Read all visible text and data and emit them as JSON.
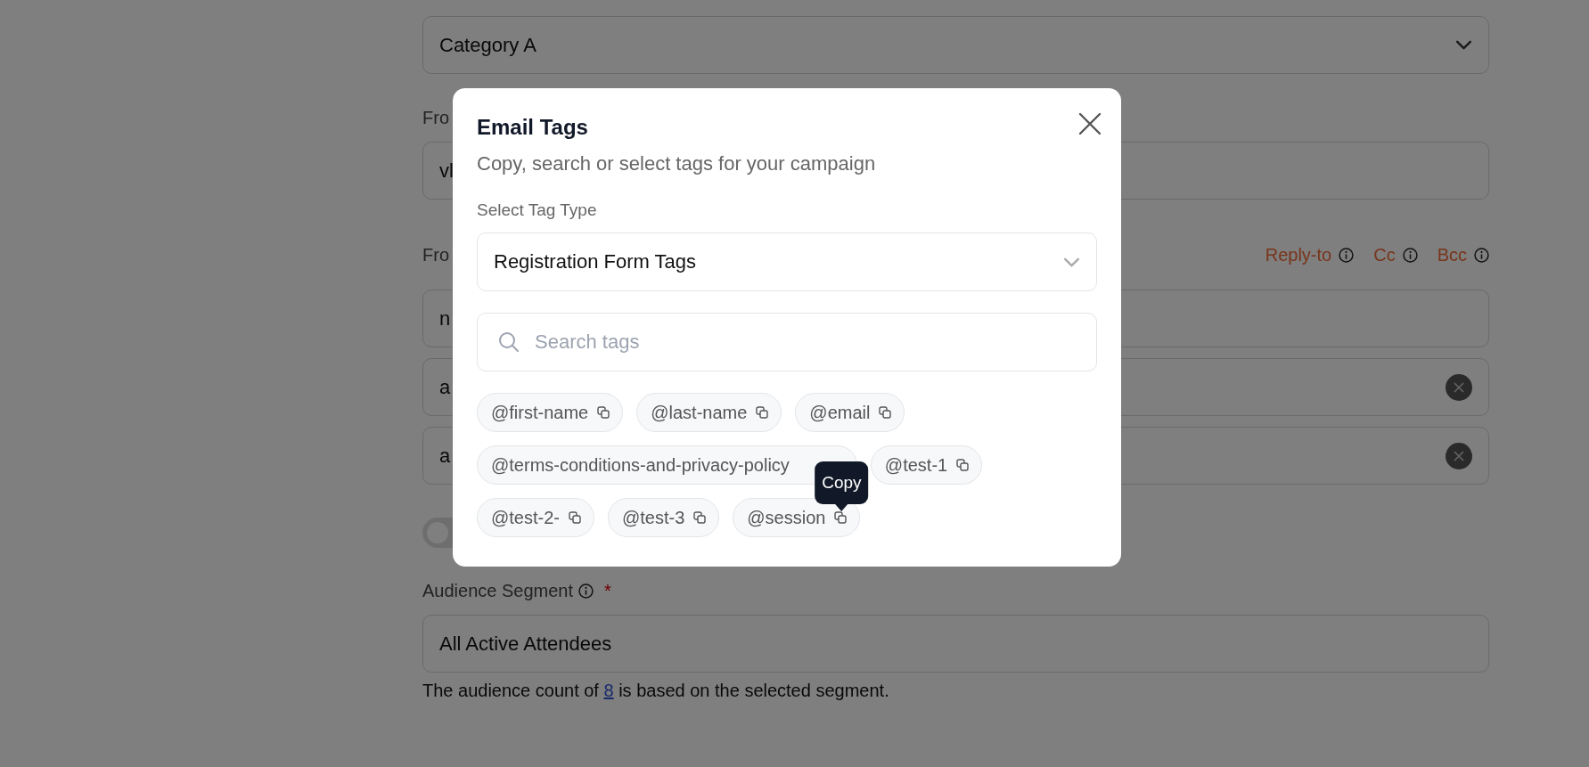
{
  "form": {
    "category_field": {
      "value": "Category A"
    },
    "from_name": {
      "label": "Fro",
      "value": "vl"
    },
    "from_email": {
      "label": "Fro",
      "links": [
        "Reply-to",
        "Cc",
        "Bcc"
      ]
    },
    "address_fields": [
      {
        "value": "n",
        "clearable": false
      },
      {
        "value": "a",
        "clearable": true
      },
      {
        "value": "a",
        "clearable": true
      }
    ],
    "toggle": {
      "on": false
    },
    "audience": {
      "label": "Audience Segment",
      "required_mark": "*",
      "value": "All Active Attendees",
      "note_before": "The audience count of ",
      "count": "8",
      "note_after": " is based on the selected segment."
    }
  },
  "modal": {
    "title": "Email Tags",
    "subtitle": "Copy, search or select tags for your campaign",
    "select_label": "Select Tag Type",
    "select_value": "Registration Form Tags",
    "search_placeholder": "Search tags",
    "tag_rows": [
      [
        {
          "label": "@first-name",
          "covered": false
        },
        {
          "label": "@last-name",
          "covered": false
        },
        {
          "label": "@email",
          "covered": false
        }
      ],
      [
        {
          "label": "@terms-conditions-and-privacy-policy",
          "covered": true
        },
        {
          "label": "@test-1",
          "covered": false
        }
      ],
      [
        {
          "label": "@test-2-",
          "covered": false
        },
        {
          "label": "@test-3",
          "covered": false
        },
        {
          "label": "@session",
          "covered": false,
          "tooltip": "Copy"
        }
      ]
    ]
  }
}
